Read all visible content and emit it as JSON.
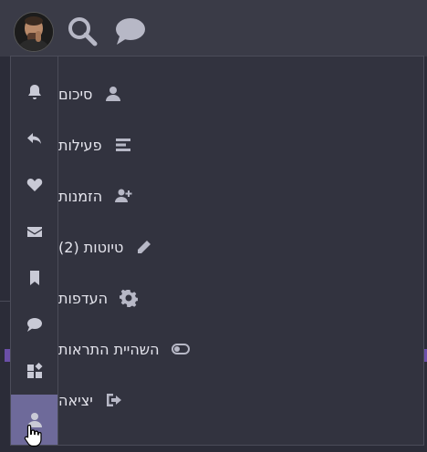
{
  "header": {
    "avatar_alt": "user avatar",
    "search_icon": "search-icon",
    "chat_icon": "chat-bubble-icon"
  },
  "rail": {
    "items": [
      {
        "icon": "bell-icon"
      },
      {
        "icon": "reply-icon"
      },
      {
        "icon": "heart-icon"
      },
      {
        "icon": "envelope-icon"
      },
      {
        "icon": "bookmark-icon"
      },
      {
        "icon": "chat-icon"
      },
      {
        "icon": "apps-icon"
      },
      {
        "icon": "user-icon",
        "active": true
      }
    ]
  },
  "menu": {
    "items": [
      {
        "label": "סיכום",
        "icon": "user-icon"
      },
      {
        "label": "פעילות",
        "icon": "activity-bars-icon"
      },
      {
        "label": "הזמנות",
        "icon": "user-plus-icon"
      },
      {
        "label": "טיוטות (2)",
        "icon": "pencil-icon"
      },
      {
        "label": "העדפות",
        "icon": "gear-icon"
      },
      {
        "label": "השהיית התראות",
        "icon": "toggle-icon"
      },
      {
        "label": "יציאה",
        "icon": "sign-out-icon"
      }
    ]
  },
  "colors": {
    "background": "#2b2c38",
    "panel": "#32333f",
    "active_rail": "#6e6a9a",
    "icon": "#b7b8c6",
    "text": "#e6e6ee"
  }
}
